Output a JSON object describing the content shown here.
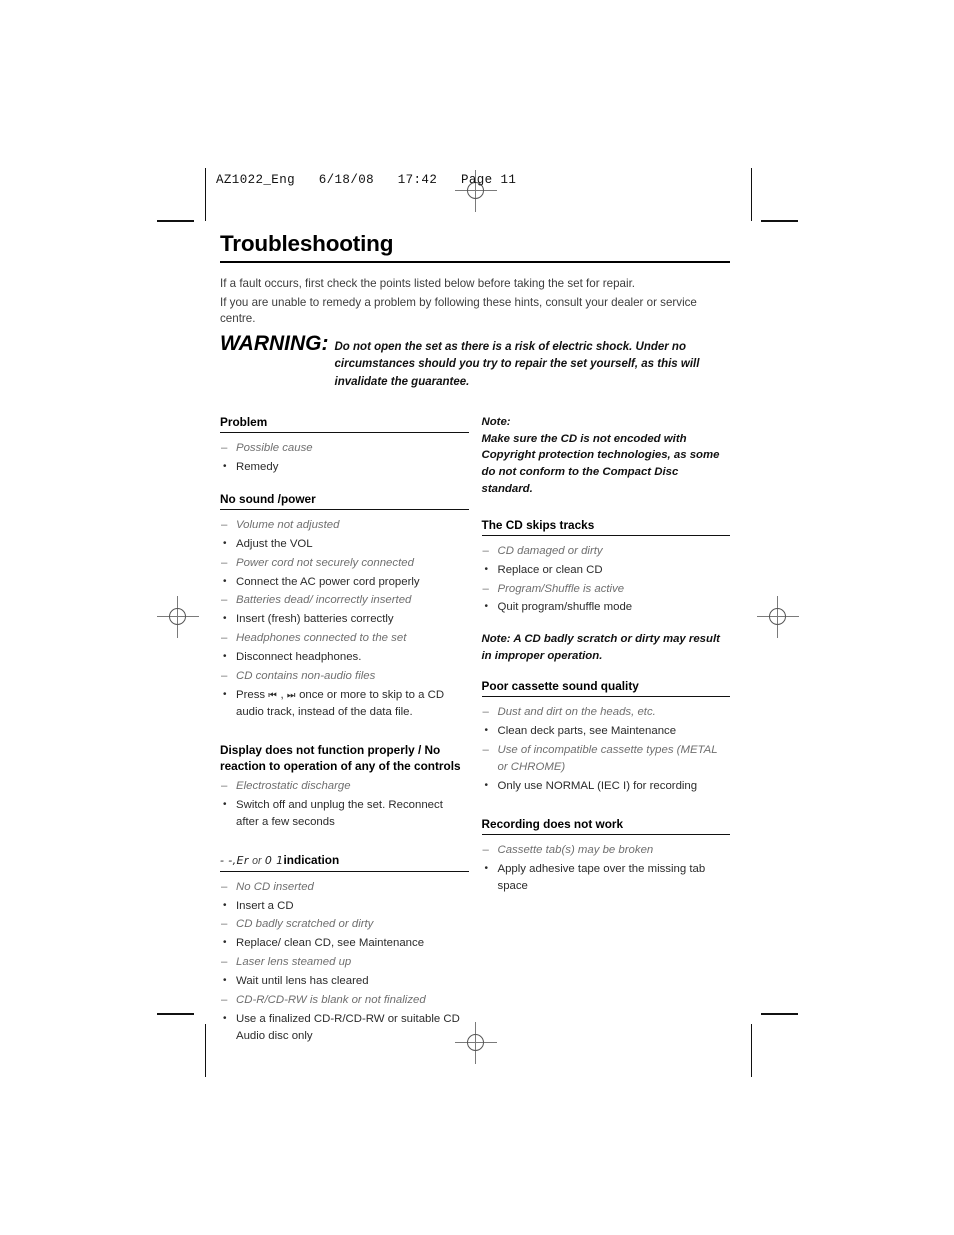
{
  "header": {
    "print_info": "AZ1022_Eng   6/18/08   17:42   Page 11"
  },
  "title": "Troubleshooting",
  "intro": {
    "line1": "If a fault occurs, first check the points listed below before taking the set for repair.",
    "line2": "If you are unable to remedy a problem by following these hints, consult your dealer or service centre."
  },
  "warning": {
    "label": "WARNING:",
    "text": "Do not open the set as there is a risk of electric shock. Under no circumstances should you try to repair the set yourself, as this will invalidate the guarantee."
  },
  "left_column": {
    "sections": [
      {
        "heading": "Problem",
        "items": [
          {
            "type": "cause",
            "text": "Possible cause"
          },
          {
            "type": "remedy",
            "text": "Remedy"
          }
        ]
      },
      {
        "heading": "No sound /power",
        "items": [
          {
            "type": "cause",
            "text": "Volume not adjusted"
          },
          {
            "type": "remedy",
            "text": "Adjust the VOL"
          },
          {
            "type": "cause",
            "text": "Power cord not securely connected"
          },
          {
            "type": "remedy",
            "text": "Connect the AC power cord properly"
          },
          {
            "type": "cause",
            "text": "Batteries dead/ incorrectly inserted"
          },
          {
            "type": "remedy",
            "text": "Insert (fresh) batteries correctly"
          },
          {
            "type": "cause",
            "text": "Headphones connected to the set"
          },
          {
            "type": "remedy",
            "text": "Disconnect headphones."
          },
          {
            "type": "cause",
            "text": "CD contains non-audio files"
          }
        ],
        "skip_remedy": {
          "prefix": "Press ",
          "glyph_back": "⏮",
          "separator": " , ",
          "glyph_forward": "⏭",
          "suffix": " once or more to skip to a CD audio track, instead of the data file."
        }
      },
      {
        "heading": "Display does not function properly / No reaction to operation of any of the controls",
        "items": [
          {
            "type": "cause",
            "text": "Electrostatic discharge"
          },
          {
            "type": "remedy",
            "text": "Switch off and unplug the set. Reconnect after a few seconds"
          }
        ]
      },
      {
        "heading_parts": {
          "lcd_code_1": "- -,",
          "lcd_code_2": "Er",
          "or_word": "or",
          "lcd_code_3": "0 1",
          "bold_word": "indication"
        },
        "items": [
          {
            "type": "cause",
            "text": "No CD inserted"
          },
          {
            "type": "remedy",
            "text": "Insert a CD"
          },
          {
            "type": "cause",
            "text": "CD badly scratched or dirty"
          },
          {
            "type": "remedy",
            "text": "Replace/ clean CD, see Maintenance"
          },
          {
            "type": "cause",
            "text": "Laser lens steamed up"
          },
          {
            "type": "remedy",
            "text": "Wait until lens has cleared"
          },
          {
            "type": "cause",
            "text": "CD-R/CD-RW is blank or not finalized"
          },
          {
            "type": "remedy",
            "text": "Use a finalized CD-R/CD-RW or suitable CD Audio disc only"
          }
        ]
      }
    ]
  },
  "right_column": {
    "note_top": {
      "label": "Note:",
      "text": "Make sure the CD is not encoded with Copyright protection technologies, as some do not conform to the Compact Disc standard."
    },
    "sections": [
      {
        "heading": "The CD skips tracks",
        "items": [
          {
            "type": "cause",
            "text": "CD damaged or dirty"
          },
          {
            "type": "remedy",
            "text": "Replace or clean CD"
          },
          {
            "type": "cause",
            "text": "Program/Shuffle is active"
          },
          {
            "type": "remedy",
            "text": "Quit program/shuffle mode"
          }
        ]
      },
      {
        "heading": "Poor cassette sound quality",
        "items": [
          {
            "type": "cause",
            "text": "Dust and dirt on the heads, etc."
          },
          {
            "type": "remedy",
            "text": "Clean deck parts, see Maintenance"
          },
          {
            "type": "cause",
            "text": "Use of incompatible cassette types (METAL or CHROME)"
          },
          {
            "type": "remedy",
            "text": "Only use NORMAL (IEC I) for recording"
          }
        ]
      },
      {
        "heading": "Recording does not work",
        "items": [
          {
            "type": "cause",
            "text": "Cassette tab(s) may be broken"
          },
          {
            "type": "remedy",
            "text": "Apply adhesive tape over the missing tab space"
          }
        ]
      }
    ],
    "note_mid": {
      "text": "Note: A CD badly scratch or dirty may result in improper operation."
    }
  }
}
